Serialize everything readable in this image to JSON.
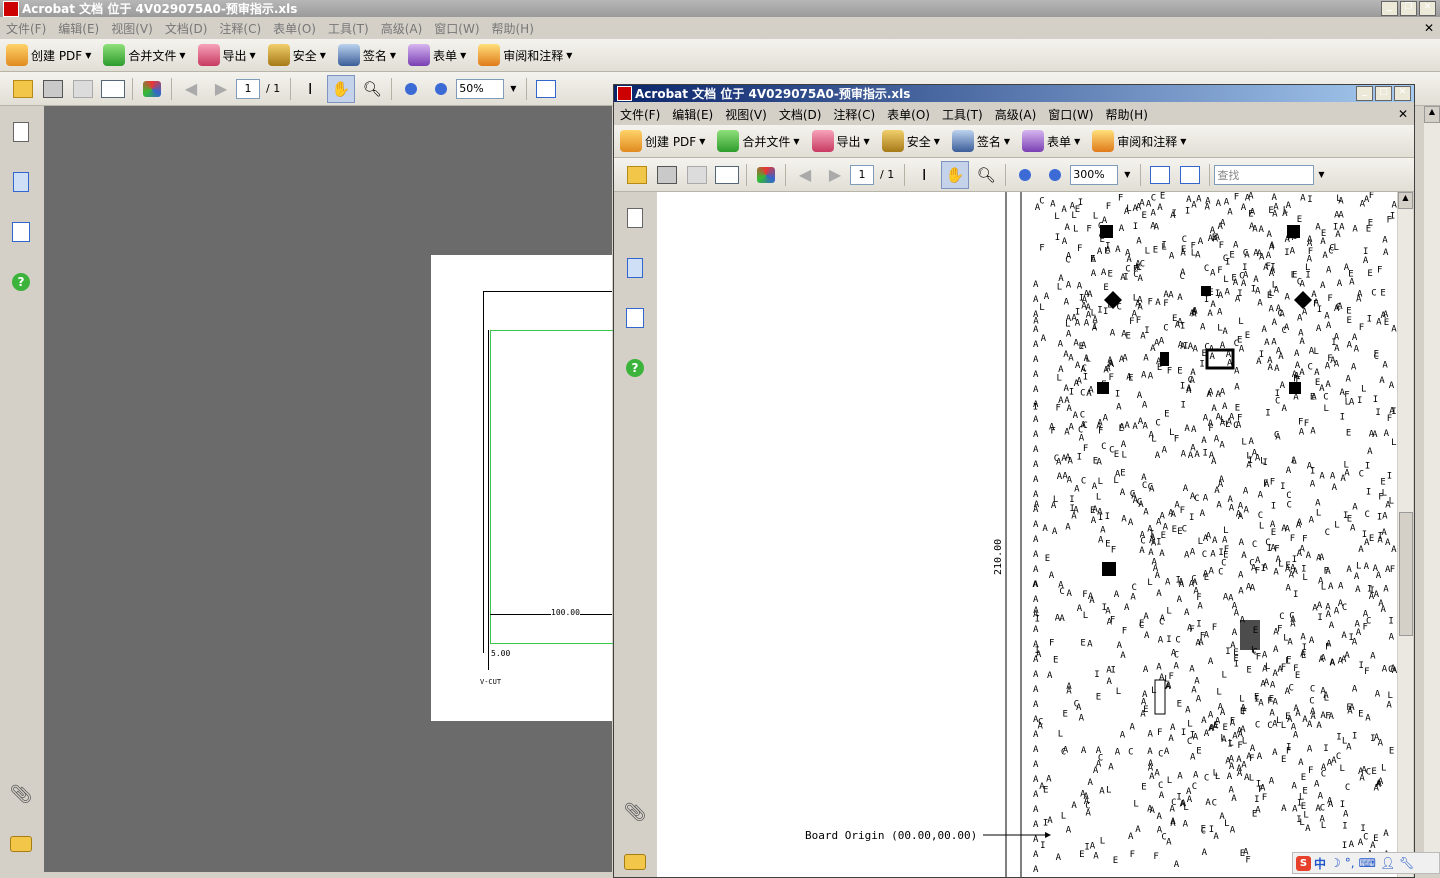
{
  "outer": {
    "title": "Acrobat 文档 位于 4V029075A0-预审指示.xls",
    "menu": [
      "文件(F)",
      "编辑(E)",
      "视图(V)",
      "文档(D)",
      "注释(C)",
      "表单(O)",
      "工具(T)",
      "高级(A)",
      "窗口(W)",
      "帮助(H)"
    ],
    "tasks": [
      {
        "label": "创建 PDF",
        "icon": "create-pdf-icon"
      },
      {
        "label": "合并文件",
        "icon": "combine-files-icon"
      },
      {
        "label": "导出",
        "icon": "export-icon"
      },
      {
        "label": "安全",
        "icon": "security-lock-icon"
      },
      {
        "label": "签名",
        "icon": "sign-pen-icon"
      },
      {
        "label": "表单",
        "icon": "forms-icon"
      },
      {
        "label": "审阅和注释",
        "icon": "review-comment-icon"
      }
    ],
    "page_num": "1",
    "page_total": "/ 1",
    "zoom": "50%",
    "drawing": {
      "dim_100": "100.00",
      "dim_5": "5.00",
      "vcut": "V-CUT"
    }
  },
  "inner": {
    "title": "Acrobat 文档 位于 4V029075A0-预审指示.xls",
    "menu": [
      "文件(F)",
      "编辑(E)",
      "视图(V)",
      "文档(D)",
      "注释(C)",
      "表单(O)",
      "工具(T)",
      "高级(A)",
      "窗口(W)",
      "帮助(H)"
    ],
    "tasks": [
      {
        "label": "创建 PDF",
        "icon": "create-pdf-icon"
      },
      {
        "label": "合并文件",
        "icon": "combine-files-icon"
      },
      {
        "label": "导出",
        "icon": "export-icon"
      },
      {
        "label": "安全",
        "icon": "security-lock-icon"
      },
      {
        "label": "签名",
        "icon": "sign-pen-icon"
      },
      {
        "label": "表单",
        "icon": "forms-icon"
      },
      {
        "label": "审阅和注释",
        "icon": "review-comment-icon"
      }
    ],
    "page_num": "1",
    "page_total": "/ 1",
    "zoom": "300%",
    "search_placeholder": "查找",
    "drawing": {
      "dim_210": "210.00",
      "board_origin": "Board Origin (00.00,00.00)"
    }
  },
  "colors": {
    "chrome": "#d4d0c8",
    "doc_bg": "#6b6b6b",
    "active_title": "#0a246a",
    "inactive_title": "#a0a0a0",
    "green_line": "#3cc84a"
  },
  "tray": {
    "ime": "中"
  }
}
